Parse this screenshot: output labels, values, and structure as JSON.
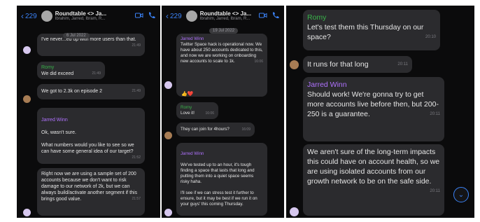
{
  "panel1": {
    "header": {
      "back_count": "229",
      "title": "Roundtable <> Ja...",
      "subtitle": "Ibrahim, Jarred, Ibram, R..."
    },
    "messages": [
      {
        "text": "I've never...ed up with more users than that.",
        "date": "6 Jul 2022",
        "time": "21:49"
      },
      {
        "sender": "Romy",
        "text": "We did exceed",
        "time": "21:49"
      },
      {
        "text": "We got to 2.3k on episode 2",
        "time": "21:49"
      },
      {
        "sender": "Jarred Winn",
        "text": "Ok, wasn't sure.\n\nWhat numbers would you like to see so we can have some general idea of our target?",
        "time": "21:52"
      },
      {
        "text": "Right now we are using a sample set of 200 accounts because we don't want to risk damage to our network of 2k, but we can always build/activate another segment if this brings good value.",
        "time": "21:57"
      }
    ]
  },
  "panel2": {
    "header": {
      "back_count": "229",
      "title": "Roundtable <> Ja...",
      "subtitle": "Ibrahim, Jarred, Ibram, R..."
    },
    "messages": [
      {
        "sender": "Jarred Winn",
        "date": "19 Jul 2022",
        "text": "Twitter Space hack is operational now. We have about 250 accounts dedicated to this, and now we are working on onboarding new accounts to scale to 1k.",
        "time": "16:06"
      },
      {
        "sender": "Romy",
        "text": "Love it!",
        "time": "16:06"
      },
      {
        "text": "They can join for 4hours?",
        "time": "16:09"
      },
      {
        "sender": "Jarred Winn",
        "text": "We've tested up to an hour, it's tough finding a space that lasts that long and putting them into a quiet space seems risky haha.\n\nI'll see if we can stress test it further to ensure, but it may be best if we run it on your guys' this coming Thursday.",
        "time": ""
      }
    ]
  },
  "panel3": {
    "messages": [
      {
        "sender": "Romy",
        "text": "Let's test them this Thursday on our space?",
        "time": "20:10"
      },
      {
        "text": "It runs for that long",
        "time": "20:11"
      },
      {
        "sender": "Jarred Winn",
        "text": "Should work! We're gonna try to get more accounts live before then, but 200-250 is a guarantee.",
        "time": "20:11"
      },
      {
        "text": "We aren't sure of the long-term impacts this could have on account health, so we are using isolated accounts from our growth network to be on the safe side.",
        "time": "20:11"
      }
    ]
  },
  "icons": {
    "chevron": "chevron-left-icon",
    "video": "video-icon",
    "phone": "phone-icon",
    "scroll": "chevron-down-icon"
  },
  "colors": {
    "accent": "#3b82f6",
    "bubble": "#2b2b2e",
    "romy": "#39b34a",
    "jarred": "#b072ff"
  }
}
